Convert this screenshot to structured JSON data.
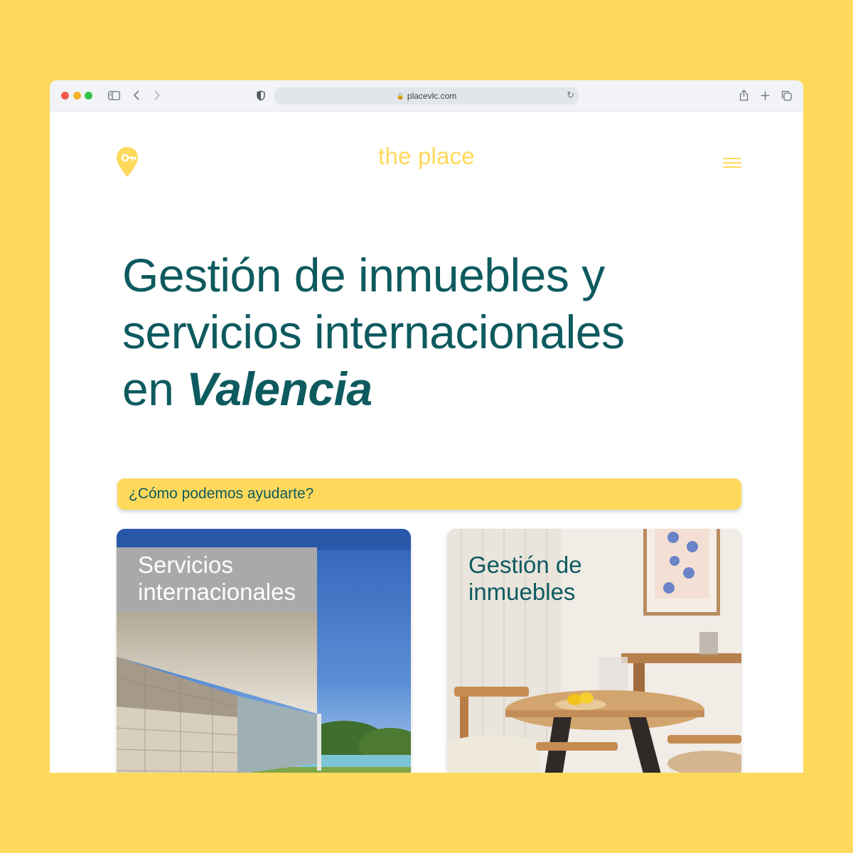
{
  "browser": {
    "url": "placevlc.com",
    "icons": [
      "close-dot",
      "minimize-dot",
      "maximize-dot",
      "sidebar-icon",
      "back-icon",
      "forward-icon",
      "privacy-shield-icon",
      "lock-icon",
      "reload-icon",
      "share-icon",
      "new-tab-icon",
      "tabs-overview-icon"
    ]
  },
  "header": {
    "brand": "the place",
    "logo_icon": "map-pin-key-icon",
    "menu_icon": "hamburger-menu-icon"
  },
  "hero": {
    "line1": "Gestión de inmuebles y",
    "line2": "servicios internacionales",
    "line3_prefix": "en ",
    "line3_emphasis": "Valencia"
  },
  "help": {
    "label": "¿Cómo podemos ayudarte?"
  },
  "cards": [
    {
      "title_line1": "Servicios",
      "title_line2": "internacionales",
      "image": "modern-villa-with-pool"
    },
    {
      "title_line1": "Gestión de",
      "title_line2": "inmuebles",
      "image": "dining-room-interior"
    }
  ],
  "colors": {
    "background": "#ffd95c",
    "brand_yellow": "#ffd95c",
    "text_teal": "#0d5a5f"
  }
}
